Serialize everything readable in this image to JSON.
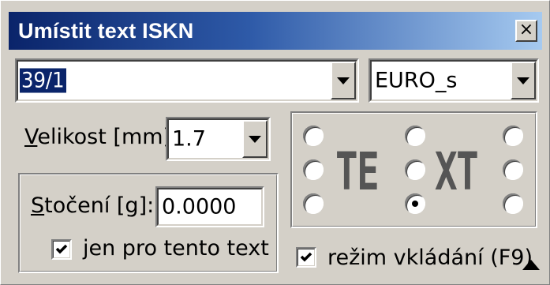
{
  "window": {
    "title": "Umístit text ISKN",
    "close_glyph": "×"
  },
  "text_combo": {
    "value": "39/1"
  },
  "font_combo": {
    "value": "EURO_s"
  },
  "size": {
    "label_prefix": "V",
    "label_rest": "elikost [mm]:",
    "value": "1.7"
  },
  "rotation": {
    "label_prefix": "S",
    "label_rest": "točení [g]:",
    "value": "0.0000",
    "only_this_text_label": "jen pro tento text",
    "only_this_text_checked": true
  },
  "alignment": {
    "preview_left": "TE",
    "preview_right": "XT",
    "selected": "bottom-center"
  },
  "insert_mode": {
    "label": "režim vkládání (F9)",
    "checked": true
  }
}
